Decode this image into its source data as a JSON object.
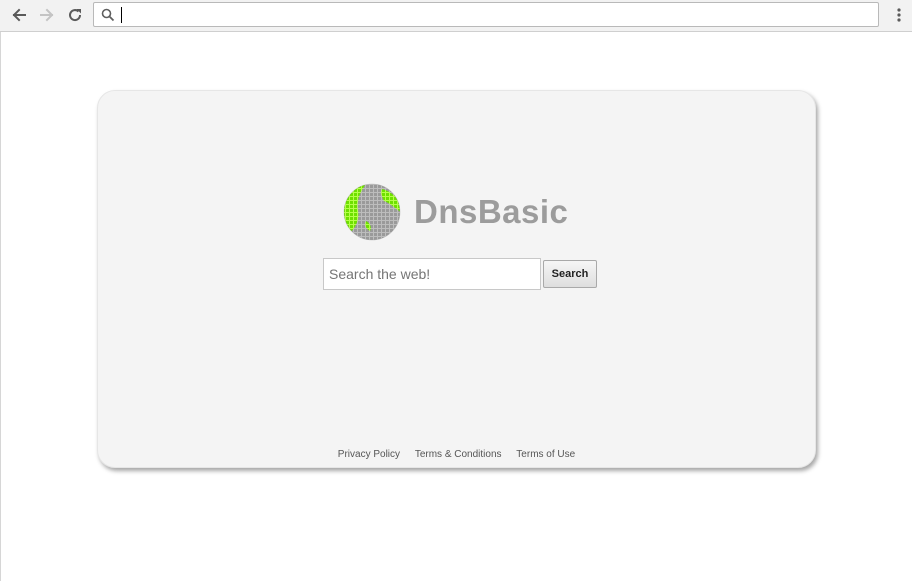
{
  "browser": {
    "omnibox": {
      "value": "",
      "placeholder": ""
    },
    "icons": {
      "back": "arrow-left-icon",
      "forward": "arrow-right-icon",
      "reload": "reload-icon",
      "search": "search-icon",
      "menu": "kebab-menu-icon"
    }
  },
  "page": {
    "logo": {
      "brand_name": "DnsBasic",
      "colors": {
        "text": "#9c9c9c",
        "globe_green": "#7cf000",
        "globe_gray": "#a9a9a9"
      }
    },
    "search": {
      "placeholder": "Search the web!",
      "button_label": "Search"
    },
    "footer": {
      "links": [
        {
          "label": "Privacy Policy"
        },
        {
          "label": "Terms & Conditions"
        },
        {
          "label": "Terms of Use"
        }
      ]
    }
  }
}
